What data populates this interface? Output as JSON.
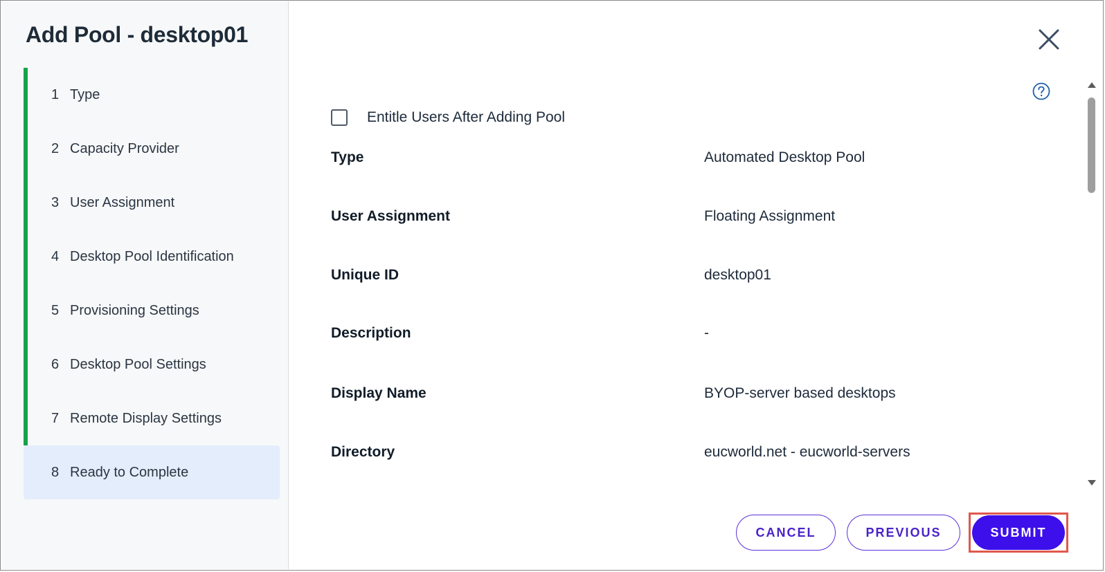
{
  "dialog": {
    "title": "Add Pool - desktop01"
  },
  "steps": [
    {
      "num": "1",
      "label": "Type"
    },
    {
      "num": "2",
      "label": "Capacity Provider"
    },
    {
      "num": "3",
      "label": "User Assignment"
    },
    {
      "num": "4",
      "label": "Desktop Pool Identification"
    },
    {
      "num": "5",
      "label": "Provisioning Settings"
    },
    {
      "num": "6",
      "label": "Desktop Pool Settings"
    },
    {
      "num": "7",
      "label": "Remote Display Settings"
    },
    {
      "num": "8",
      "label": "Ready to Complete"
    }
  ],
  "content": {
    "entitle_checkbox": {
      "label": "Entitle Users After Adding Pool",
      "checked": false
    },
    "fields": [
      {
        "label": "Type",
        "value": "Automated Desktop Pool"
      },
      {
        "label": "User Assignment",
        "value": "Floating Assignment"
      },
      {
        "label": "Unique ID",
        "value": "desktop01"
      },
      {
        "label": "Description",
        "value": "-"
      },
      {
        "label": "Display Name",
        "value": "BYOP-server based desktops"
      },
      {
        "label": "Directory",
        "value": "eucworld.net - eucworld-servers"
      }
    ]
  },
  "footer": {
    "cancel_label": "CANCEL",
    "previous_label": "PREVIOUS",
    "submit_label": "SUBMIT"
  },
  "icons": {
    "close": "close-icon",
    "help": "help-icon"
  },
  "colors": {
    "accent": "#3d0fea",
    "completed_step": "#17a24a",
    "active_step_bg": "#e4edfb",
    "highlight": "#e2574c"
  }
}
